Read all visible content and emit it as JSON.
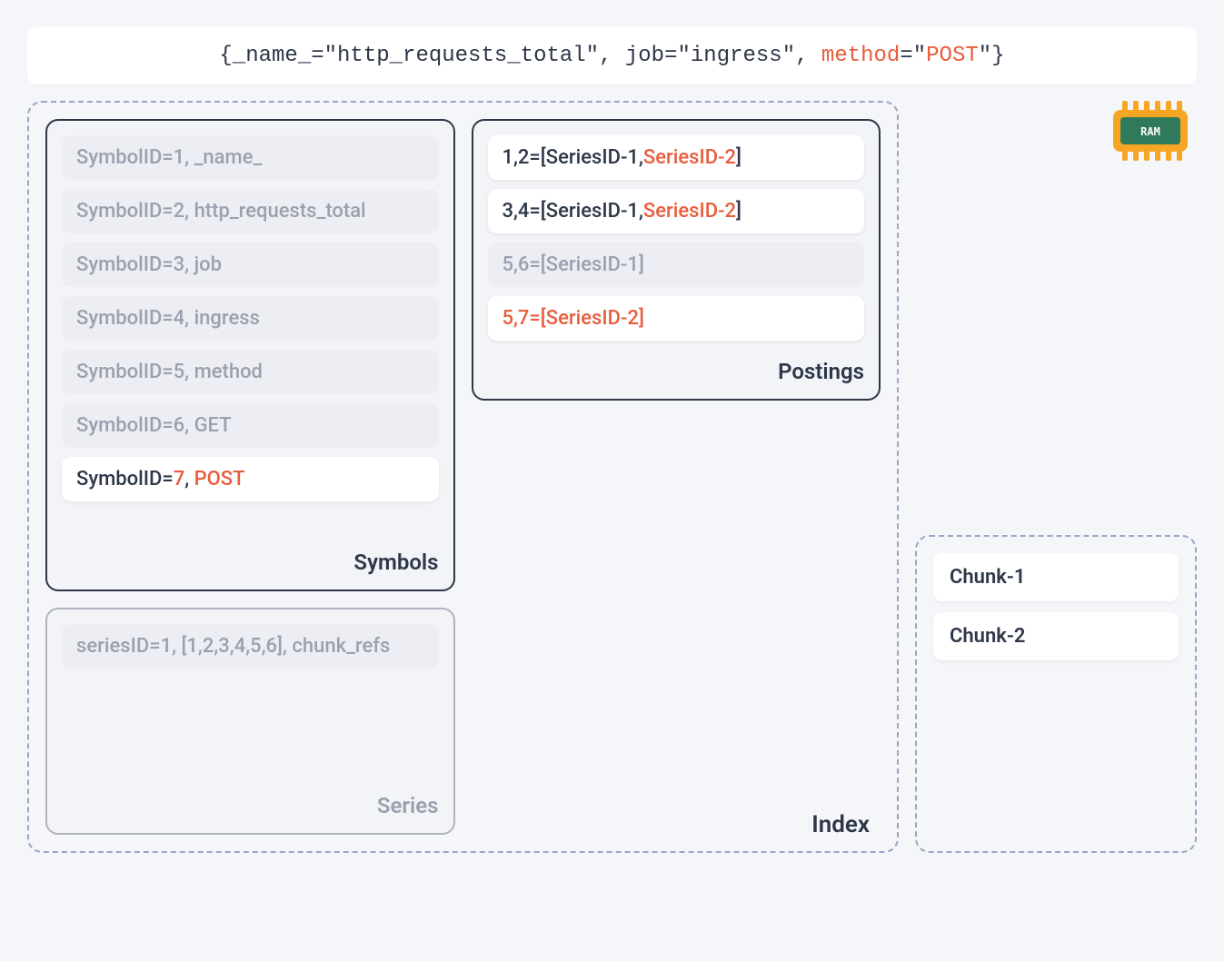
{
  "query": {
    "parts": [
      {
        "text": "{_name_=\"http_requests_total\", job=\"ingress\", ",
        "hl": false
      },
      {
        "text": "method",
        "hl": true
      },
      {
        "text": "=\"",
        "hl": false
      },
      {
        "text": "POST",
        "hl": true
      },
      {
        "text": "\"}",
        "hl": false
      }
    ]
  },
  "index": {
    "label": "Index",
    "symbols": {
      "label": "Symbols",
      "items": [
        {
          "active": false,
          "spans": [
            {
              "text": "SymbolID=1, _name_",
              "hl": false
            }
          ]
        },
        {
          "active": false,
          "spans": [
            {
              "text": "SymbolID=2, http_requests_total",
              "hl": false
            }
          ]
        },
        {
          "active": false,
          "spans": [
            {
              "text": "SymbolID=3, job",
              "hl": false
            }
          ]
        },
        {
          "active": false,
          "spans": [
            {
              "text": "SymbolID=4, ingress",
              "hl": false
            }
          ]
        },
        {
          "active": false,
          "spans": [
            {
              "text": "SymbolID=5, method",
              "hl": false
            }
          ]
        },
        {
          "active": false,
          "spans": [
            {
              "text": "SymbolID=6, GET",
              "hl": false
            }
          ]
        },
        {
          "active": true,
          "spans": [
            {
              "text": "SymbolID=",
              "hl": false
            },
            {
              "text": "7",
              "hl": true
            },
            {
              "text": ", ",
              "hl": false
            },
            {
              "text": "POST",
              "hl": true
            }
          ]
        }
      ]
    },
    "postings": {
      "label": "Postings",
      "items": [
        {
          "active": true,
          "spans": [
            {
              "text": "1,2=[SeriesID-1,",
              "hl": false
            },
            {
              "text": "SeriesID-2",
              "hl": true
            },
            {
              "text": "]",
              "hl": false
            }
          ]
        },
        {
          "active": true,
          "spans": [
            {
              "text": "3,4=[SeriesID-1,",
              "hl": false
            },
            {
              "text": "SeriesID-2",
              "hl": true
            },
            {
              "text": "]",
              "hl": false
            }
          ]
        },
        {
          "active": false,
          "spans": [
            {
              "text": "5,6=[SeriesID-1]",
              "hl": false
            }
          ]
        },
        {
          "active": true,
          "spans": [
            {
              "text": "5,7=[SeriesID-2]",
              "hl": true
            }
          ]
        }
      ]
    },
    "series": {
      "label": "Series",
      "items": [
        {
          "active": false,
          "spans": [
            {
              "text": "seriesID=1, [1,2,3,4,5,6], chunk_refs",
              "hl": false
            }
          ]
        }
      ]
    }
  },
  "chunks": {
    "items": [
      {
        "label": "Chunk-1"
      },
      {
        "label": "Chunk-2"
      }
    ]
  },
  "ram_label": "RAM"
}
